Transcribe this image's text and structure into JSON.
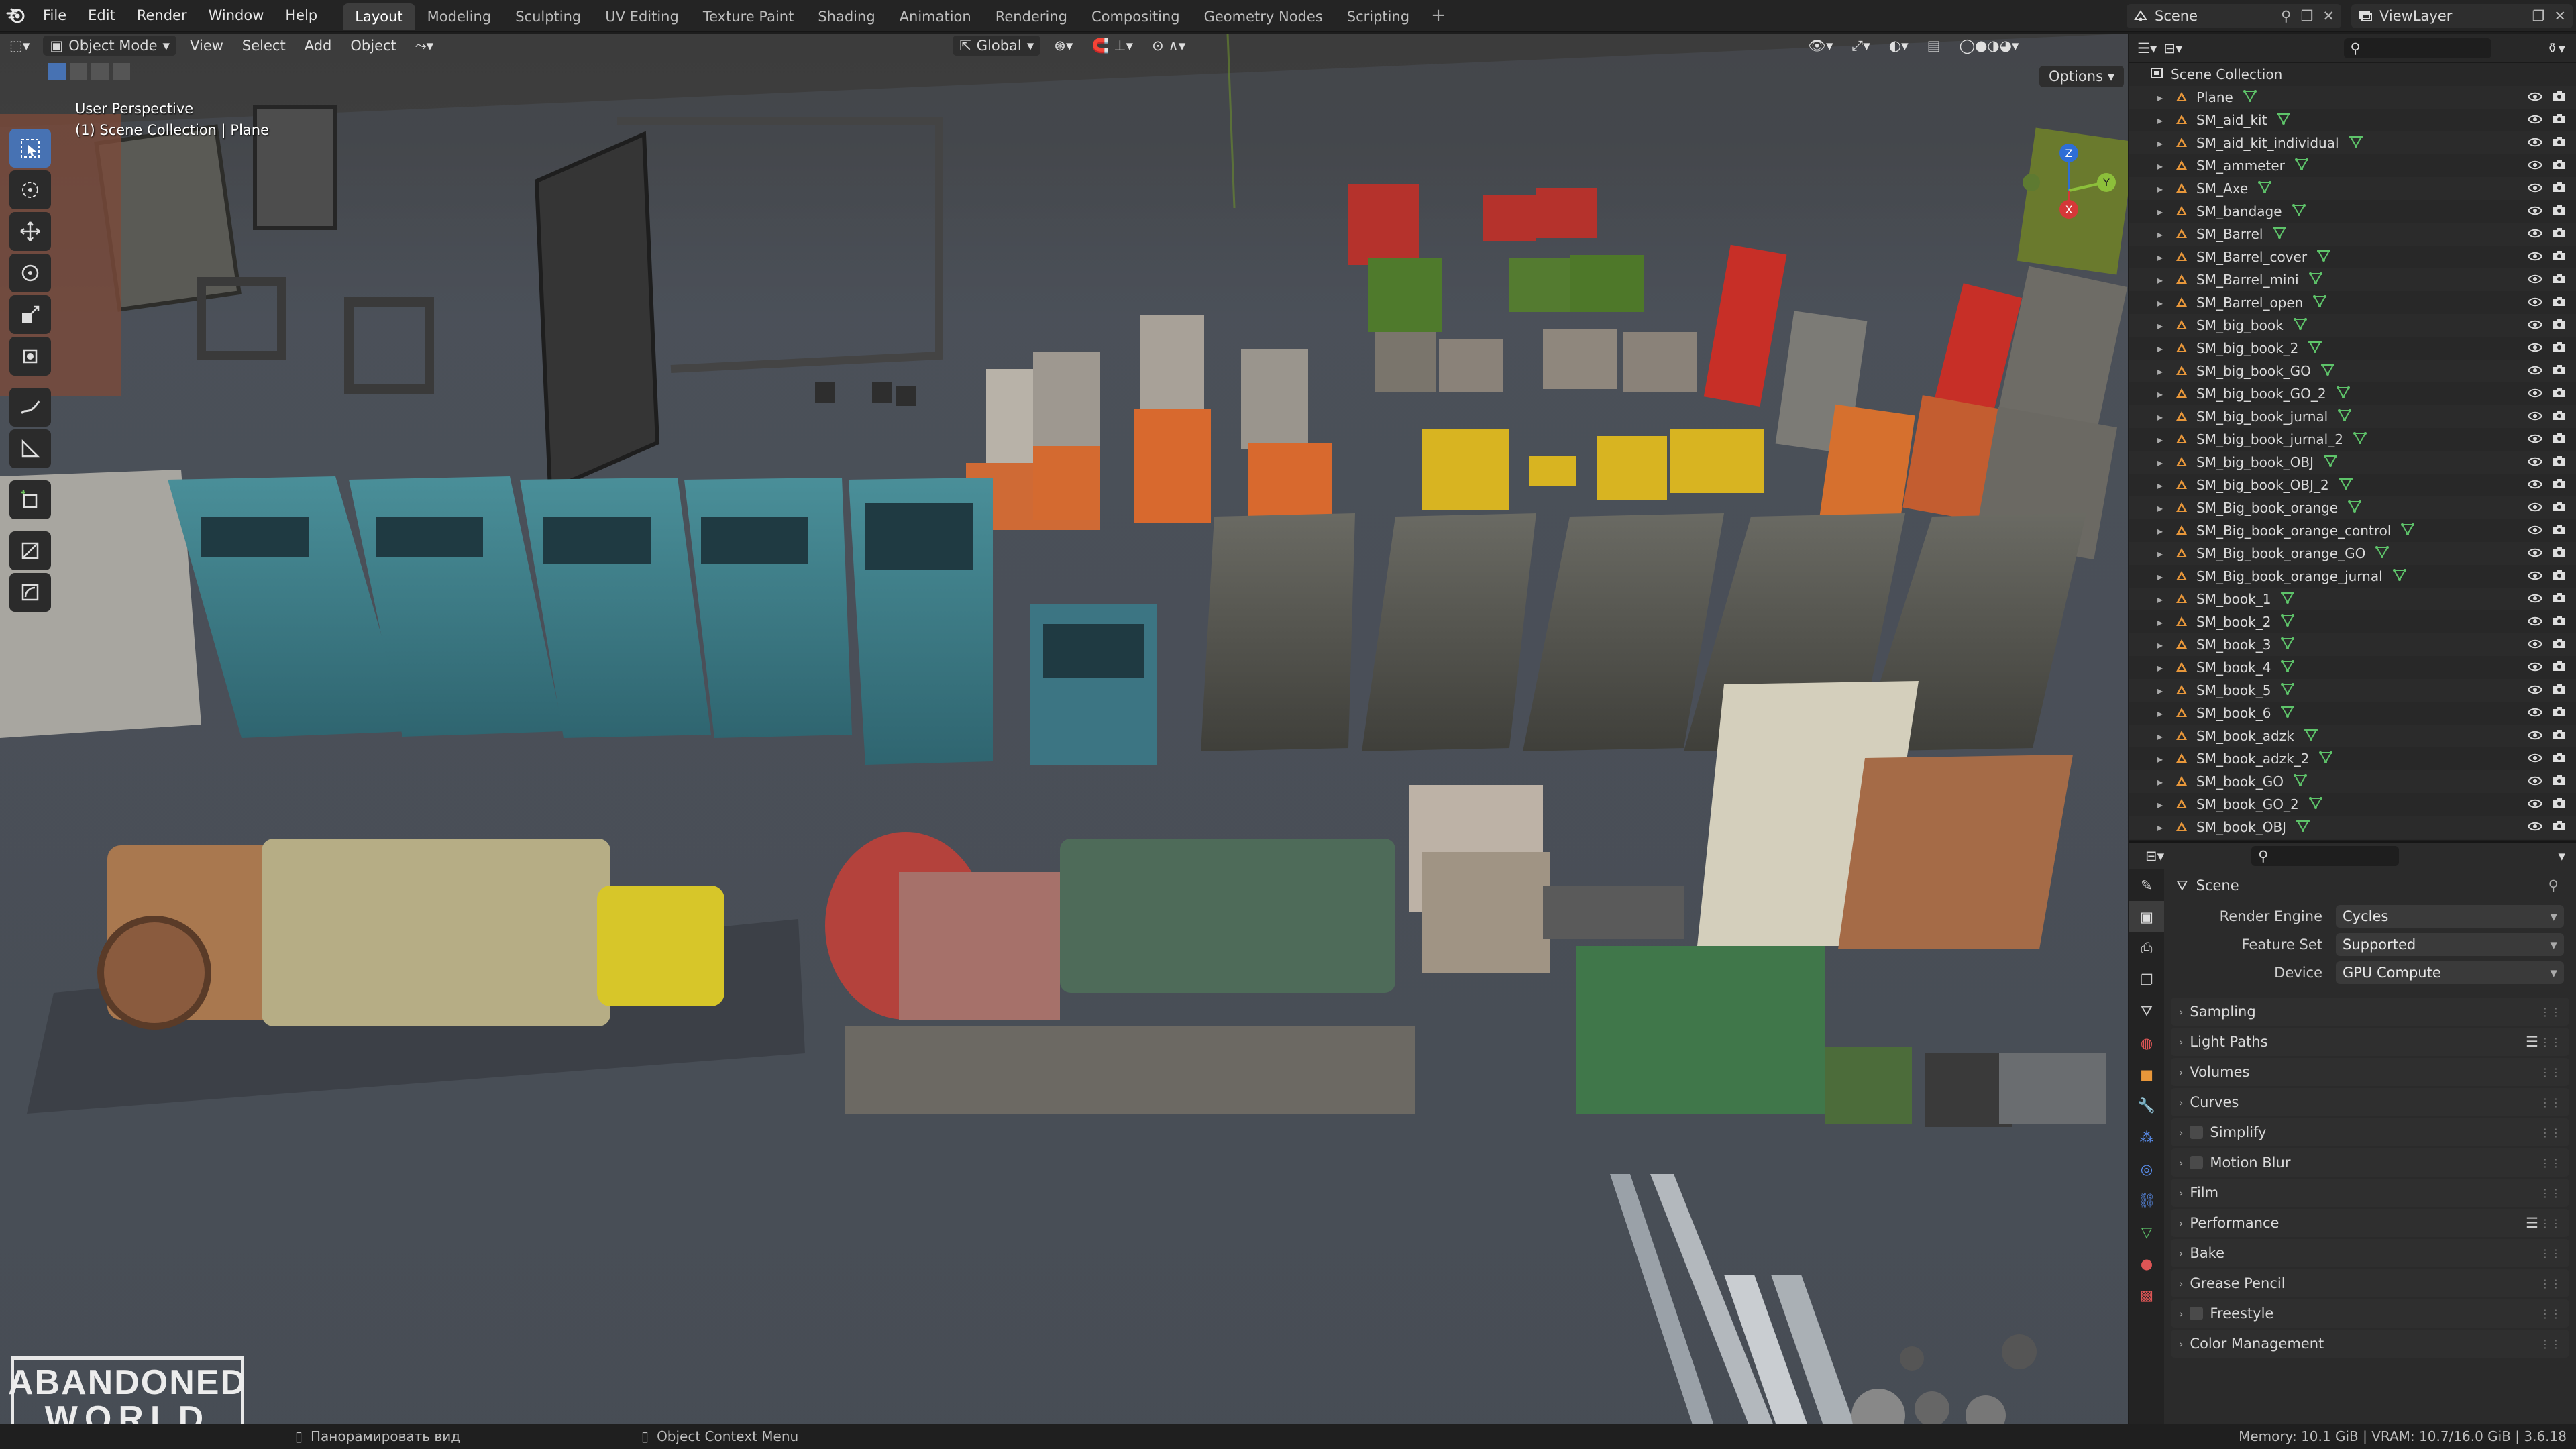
{
  "topbar": {
    "menu": [
      "File",
      "Edit",
      "Render",
      "Window",
      "Help"
    ],
    "workspaces": [
      "Layout",
      "Modeling",
      "Sculpting",
      "UV Editing",
      "Texture Paint",
      "Shading",
      "Animation",
      "Rendering",
      "Compositing",
      "Geometry Nodes",
      "Scripting"
    ],
    "active_workspace": "Layout",
    "add_tab": "+",
    "scene": "Scene",
    "view_layer": "ViewLayer"
  },
  "viewport_header": {
    "mode": "Object Mode",
    "menus": [
      "View",
      "Select",
      "Add",
      "Object"
    ],
    "orientation": "Global",
    "options": "Options"
  },
  "viewport": {
    "view_name": "User Perspective",
    "collection_path": "(1) Scene Collection | Plane",
    "gizmo_labels": {
      "x": "X",
      "y": "Y",
      "z": "Z"
    },
    "watermark": [
      "ABANDONED",
      "WORLD"
    ],
    "colors": {
      "teal_cabinet": "#3f7f8a",
      "orange_box": "#d8692e",
      "yellow_box": "#d8b421",
      "red_box": "#b5322c",
      "gray_cabinet": "#5b5b55"
    }
  },
  "outliner": {
    "root": "Scene Collection",
    "items": [
      "Plane",
      "SM_aid_kit",
      "SM_aid_kit_individual",
      "SM_ammeter",
      "SM_Axe",
      "SM_bandage",
      "SM_Barrel",
      "SM_Barrel_cover",
      "SM_Barrel_mini",
      "SM_Barrel_open",
      "SM_big_book",
      "SM_big_book_2",
      "SM_big_book_GO",
      "SM_big_book_GO_2",
      "SM_big_book_jurnal",
      "SM_big_book_jurnal_2",
      "SM_big_book_OBJ",
      "SM_big_book_OBJ_2",
      "SM_Big_book_orange",
      "SM_Big_book_orange_control",
      "SM_Big_book_orange_GO",
      "SM_Big_book_orange_jurnal",
      "SM_book_1",
      "SM_book_2",
      "SM_book_3",
      "SM_book_4",
      "SM_book_5",
      "SM_book_6",
      "SM_book_adzk",
      "SM_book_adzk_2",
      "SM_book_GO",
      "SM_book_GO_2",
      "SM_book_OBJ"
    ]
  },
  "properties": {
    "context": "Scene",
    "fields": [
      {
        "label": "Render Engine",
        "value": "Cycles"
      },
      {
        "label": "Feature Set",
        "value": "Supported"
      },
      {
        "label": "Device",
        "value": "GPU Compute"
      }
    ],
    "panels": [
      {
        "label": "Sampling",
        "checkbox": false,
        "list": false
      },
      {
        "label": "Light Paths",
        "checkbox": false,
        "list": true
      },
      {
        "label": "Volumes",
        "checkbox": false,
        "list": false
      },
      {
        "label": "Curves",
        "checkbox": false,
        "list": false
      },
      {
        "label": "Simplify",
        "checkbox": true,
        "list": false
      },
      {
        "label": "Motion Blur",
        "checkbox": true,
        "list": false
      },
      {
        "label": "Film",
        "checkbox": false,
        "list": false
      },
      {
        "label": "Performance",
        "checkbox": false,
        "list": true
      },
      {
        "label": "Bake",
        "checkbox": false,
        "list": false
      },
      {
        "label": "Grease Pencil",
        "checkbox": false,
        "list": false
      },
      {
        "label": "Freestyle",
        "checkbox": true,
        "list": false
      },
      {
        "label": "Color Management",
        "checkbox": false,
        "list": false
      }
    ]
  },
  "statusbar": {
    "hint_middle": "Панорамировать вид",
    "hint_right": "Object Context Menu",
    "stats": "Memory: 10.1 GiB | VRAM: 10.7/16.0 GiB | 3.6.18"
  }
}
